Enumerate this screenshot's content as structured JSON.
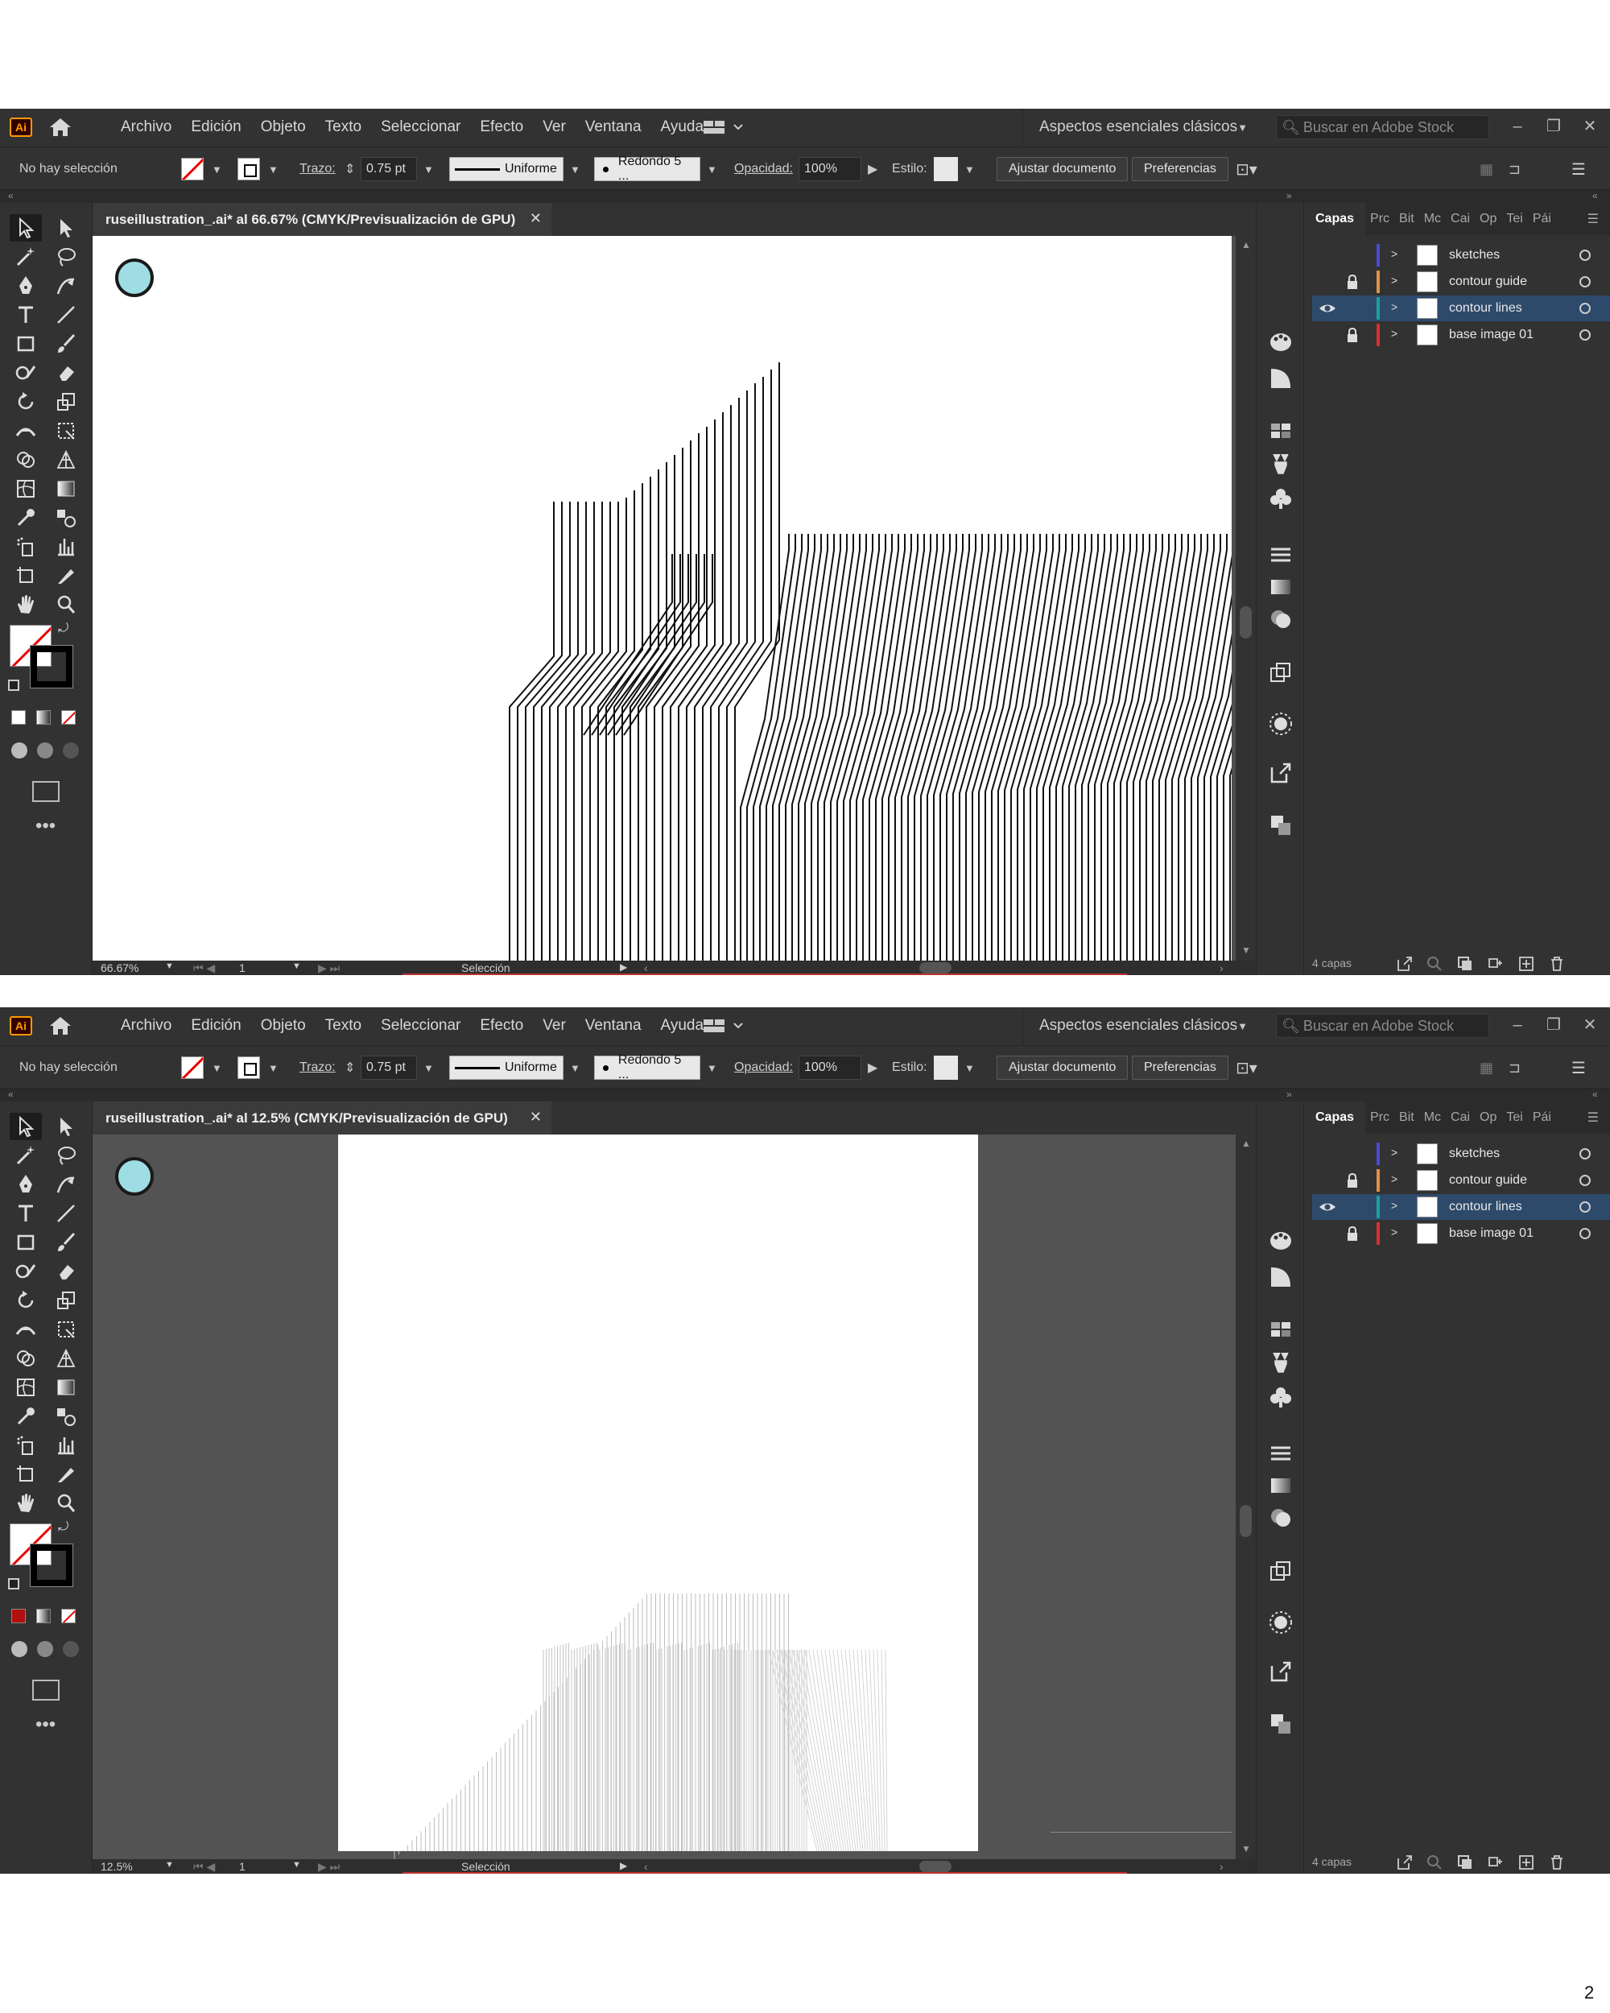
{
  "screenshots": [
    {
      "app_logo": "Ai",
      "menu": [
        "Archivo",
        "Edición",
        "Objeto",
        "Texto",
        "Seleccionar",
        "Efecto",
        "Ver",
        "Ventana",
        "Ayuda"
      ],
      "workspace": "Aspectos esenciales clásicos",
      "stock_search_placeholder": "Buscar en Adobe Stock",
      "control": {
        "selection_status": "No hay selección",
        "stroke_label": "Trazo:",
        "stroke_weight": "0.75 pt",
        "profile": "Uniforme",
        "brush": "Redondo 5 ...",
        "opacity_label": "Opacidad:",
        "opacity": "100%",
        "style_label": "Estilo:",
        "doc_setup_button": "Ajustar documento",
        "prefs_button": "Preferencias"
      },
      "document_tab": "ruseillustration_.ai* al 66.67% (CMYK/Previsualización de GPU)",
      "status": {
        "zoom": "66.67%",
        "artboard": "1",
        "tool": "Selección"
      },
      "layers_panel": {
        "tabs": [
          "Capas",
          "Prc",
          "Bit",
          "Mc",
          "Cai",
          "Op",
          "Tei",
          "Pái"
        ],
        "layers": [
          {
            "name": "sketches",
            "color": "#4a4ad8",
            "visible": false,
            "locked": false,
            "selected": false
          },
          {
            "name": "contour guide",
            "color": "#e0904a",
            "visible": false,
            "locked": true,
            "selected": false
          },
          {
            "name": "contour lines",
            "color": "#1aa0a0",
            "visible": true,
            "locked": false,
            "selected": true
          },
          {
            "name": "base image 01",
            "color": "#d83030",
            "visible": false,
            "locked": true,
            "selected": false
          }
        ],
        "count": "4 capas"
      }
    },
    {
      "app_logo": "Ai",
      "menu": [
        "Archivo",
        "Edición",
        "Objeto",
        "Texto",
        "Seleccionar",
        "Efecto",
        "Ver",
        "Ventana",
        "Ayuda"
      ],
      "workspace": "Aspectos esenciales clásicos",
      "stock_search_placeholder": "Buscar en Adobe Stock",
      "control": {
        "selection_status": "No hay selección",
        "stroke_label": "Trazo:",
        "stroke_weight": "0.75 pt",
        "profile": "Uniforme",
        "brush": "Redondo 5 ...",
        "opacity_label": "Opacidad:",
        "opacity": "100%",
        "style_label": "Estilo:",
        "doc_setup_button": "Ajustar documento",
        "prefs_button": "Preferencias"
      },
      "document_tab": "ruseillustration_.ai* al 12.5% (CMYK/Previsualización de GPU)",
      "status": {
        "zoom": "12.5%",
        "artboard": "1",
        "tool": "Selección"
      },
      "layers_panel": {
        "tabs": [
          "Capas",
          "Prc",
          "Bit",
          "Mc",
          "Cai",
          "Op",
          "Tei",
          "Pái"
        ],
        "layers": [
          {
            "name": "sketches",
            "color": "#4a4ad8",
            "visible": false,
            "locked": false,
            "selected": false
          },
          {
            "name": "contour guide",
            "color": "#e0904a",
            "visible": false,
            "locked": true,
            "selected": false
          },
          {
            "name": "contour lines",
            "color": "#1aa0a0",
            "visible": true,
            "locked": false,
            "selected": true
          },
          {
            "name": "base image 01",
            "color": "#d83030",
            "visible": false,
            "locked": true,
            "selected": false
          }
        ],
        "count": "4 capas"
      }
    }
  ],
  "page_number": "2"
}
